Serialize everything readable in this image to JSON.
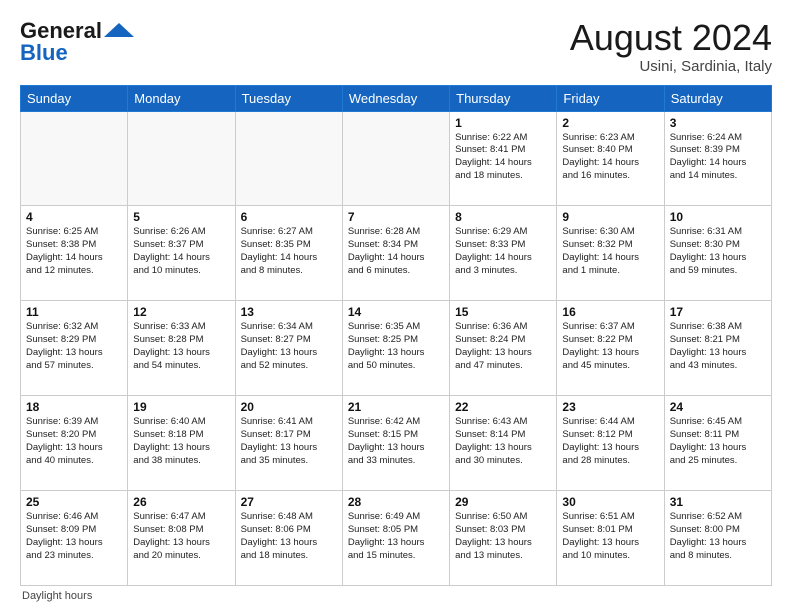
{
  "header": {
    "logo_general": "General",
    "logo_blue": "Blue",
    "month_year": "August 2024",
    "location": "Usini, Sardinia, Italy"
  },
  "days_of_week": [
    "Sunday",
    "Monday",
    "Tuesday",
    "Wednesday",
    "Thursday",
    "Friday",
    "Saturday"
  ],
  "footer": "Daylight hours",
  "weeks": [
    [
      {
        "day": "",
        "text": ""
      },
      {
        "day": "",
        "text": ""
      },
      {
        "day": "",
        "text": ""
      },
      {
        "day": "",
        "text": ""
      },
      {
        "day": "1",
        "text": "Sunrise: 6:22 AM\nSunset: 8:41 PM\nDaylight: 14 hours\nand 18 minutes."
      },
      {
        "day": "2",
        "text": "Sunrise: 6:23 AM\nSunset: 8:40 PM\nDaylight: 14 hours\nand 16 minutes."
      },
      {
        "day": "3",
        "text": "Sunrise: 6:24 AM\nSunset: 8:39 PM\nDaylight: 14 hours\nand 14 minutes."
      }
    ],
    [
      {
        "day": "4",
        "text": "Sunrise: 6:25 AM\nSunset: 8:38 PM\nDaylight: 14 hours\nand 12 minutes."
      },
      {
        "day": "5",
        "text": "Sunrise: 6:26 AM\nSunset: 8:37 PM\nDaylight: 14 hours\nand 10 minutes."
      },
      {
        "day": "6",
        "text": "Sunrise: 6:27 AM\nSunset: 8:35 PM\nDaylight: 14 hours\nand 8 minutes."
      },
      {
        "day": "7",
        "text": "Sunrise: 6:28 AM\nSunset: 8:34 PM\nDaylight: 14 hours\nand 6 minutes."
      },
      {
        "day": "8",
        "text": "Sunrise: 6:29 AM\nSunset: 8:33 PM\nDaylight: 14 hours\nand 3 minutes."
      },
      {
        "day": "9",
        "text": "Sunrise: 6:30 AM\nSunset: 8:32 PM\nDaylight: 14 hours\nand 1 minute."
      },
      {
        "day": "10",
        "text": "Sunrise: 6:31 AM\nSunset: 8:30 PM\nDaylight: 13 hours\nand 59 minutes."
      }
    ],
    [
      {
        "day": "11",
        "text": "Sunrise: 6:32 AM\nSunset: 8:29 PM\nDaylight: 13 hours\nand 57 minutes."
      },
      {
        "day": "12",
        "text": "Sunrise: 6:33 AM\nSunset: 8:28 PM\nDaylight: 13 hours\nand 54 minutes."
      },
      {
        "day": "13",
        "text": "Sunrise: 6:34 AM\nSunset: 8:27 PM\nDaylight: 13 hours\nand 52 minutes."
      },
      {
        "day": "14",
        "text": "Sunrise: 6:35 AM\nSunset: 8:25 PM\nDaylight: 13 hours\nand 50 minutes."
      },
      {
        "day": "15",
        "text": "Sunrise: 6:36 AM\nSunset: 8:24 PM\nDaylight: 13 hours\nand 47 minutes."
      },
      {
        "day": "16",
        "text": "Sunrise: 6:37 AM\nSunset: 8:22 PM\nDaylight: 13 hours\nand 45 minutes."
      },
      {
        "day": "17",
        "text": "Sunrise: 6:38 AM\nSunset: 8:21 PM\nDaylight: 13 hours\nand 43 minutes."
      }
    ],
    [
      {
        "day": "18",
        "text": "Sunrise: 6:39 AM\nSunset: 8:20 PM\nDaylight: 13 hours\nand 40 minutes."
      },
      {
        "day": "19",
        "text": "Sunrise: 6:40 AM\nSunset: 8:18 PM\nDaylight: 13 hours\nand 38 minutes."
      },
      {
        "day": "20",
        "text": "Sunrise: 6:41 AM\nSunset: 8:17 PM\nDaylight: 13 hours\nand 35 minutes."
      },
      {
        "day": "21",
        "text": "Sunrise: 6:42 AM\nSunset: 8:15 PM\nDaylight: 13 hours\nand 33 minutes."
      },
      {
        "day": "22",
        "text": "Sunrise: 6:43 AM\nSunset: 8:14 PM\nDaylight: 13 hours\nand 30 minutes."
      },
      {
        "day": "23",
        "text": "Sunrise: 6:44 AM\nSunset: 8:12 PM\nDaylight: 13 hours\nand 28 minutes."
      },
      {
        "day": "24",
        "text": "Sunrise: 6:45 AM\nSunset: 8:11 PM\nDaylight: 13 hours\nand 25 minutes."
      }
    ],
    [
      {
        "day": "25",
        "text": "Sunrise: 6:46 AM\nSunset: 8:09 PM\nDaylight: 13 hours\nand 23 minutes."
      },
      {
        "day": "26",
        "text": "Sunrise: 6:47 AM\nSunset: 8:08 PM\nDaylight: 13 hours\nand 20 minutes."
      },
      {
        "day": "27",
        "text": "Sunrise: 6:48 AM\nSunset: 8:06 PM\nDaylight: 13 hours\nand 18 minutes."
      },
      {
        "day": "28",
        "text": "Sunrise: 6:49 AM\nSunset: 8:05 PM\nDaylight: 13 hours\nand 15 minutes."
      },
      {
        "day": "29",
        "text": "Sunrise: 6:50 AM\nSunset: 8:03 PM\nDaylight: 13 hours\nand 13 minutes."
      },
      {
        "day": "30",
        "text": "Sunrise: 6:51 AM\nSunset: 8:01 PM\nDaylight: 13 hours\nand 10 minutes."
      },
      {
        "day": "31",
        "text": "Sunrise: 6:52 AM\nSunset: 8:00 PM\nDaylight: 13 hours\nand 8 minutes."
      }
    ]
  ]
}
